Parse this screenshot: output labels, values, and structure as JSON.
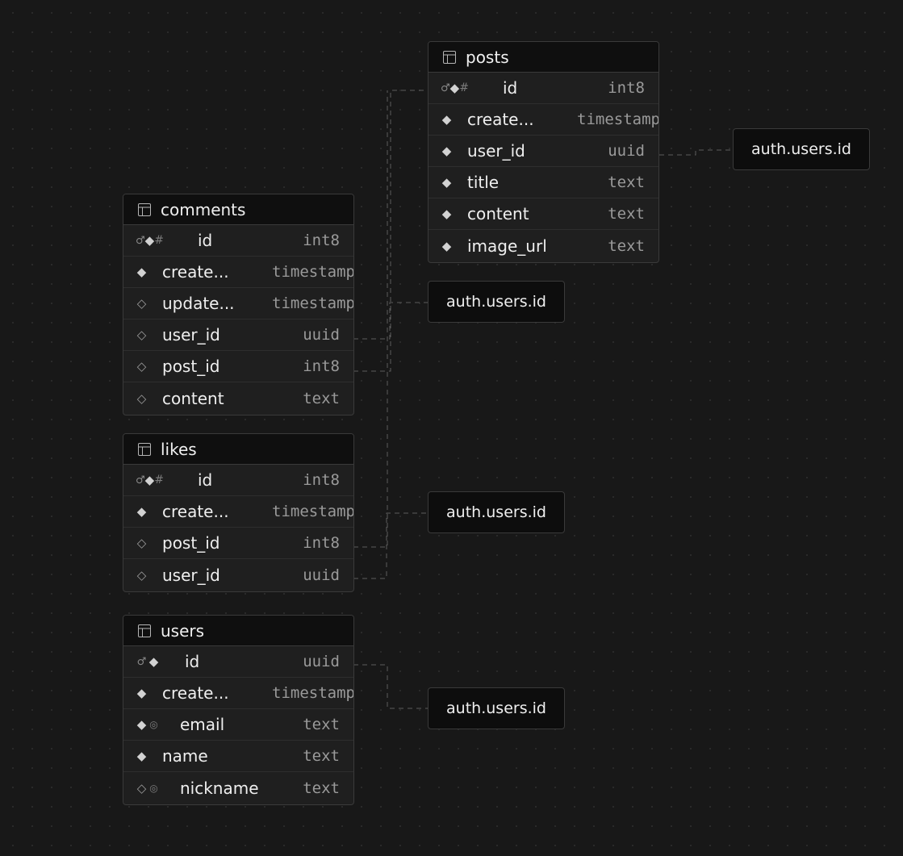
{
  "tables": [
    {
      "name": "posts",
      "columns": [
        {
          "name": "id",
          "type": "int8",
          "icons": [
            "key",
            "diamond",
            "hash"
          ]
        },
        {
          "name": "create...",
          "type": "timestamp",
          "icons": [
            "diamond"
          ]
        },
        {
          "name": "user_id",
          "type": "uuid",
          "icons": [
            "diamond"
          ]
        },
        {
          "name": "title",
          "type": "text",
          "icons": [
            "diamond"
          ]
        },
        {
          "name": "content",
          "type": "text",
          "icons": [
            "diamond"
          ]
        },
        {
          "name": "image_url",
          "type": "text",
          "icons": [
            "diamond"
          ]
        }
      ]
    },
    {
      "name": "comments",
      "columns": [
        {
          "name": "id",
          "type": "int8",
          "icons": [
            "key",
            "diamond",
            "hash"
          ]
        },
        {
          "name": "create...",
          "type": "timestamp",
          "icons": [
            "diamond"
          ]
        },
        {
          "name": "update...",
          "type": "timestamp",
          "icons": [
            "odiamond"
          ]
        },
        {
          "name": "user_id",
          "type": "uuid",
          "icons": [
            "odiamond"
          ]
        },
        {
          "name": "post_id",
          "type": "int8",
          "icons": [
            "odiamond"
          ]
        },
        {
          "name": "content",
          "type": "text",
          "icons": [
            "odiamond"
          ]
        }
      ]
    },
    {
      "name": "likes",
      "columns": [
        {
          "name": "id",
          "type": "int8",
          "icons": [
            "key",
            "diamond",
            "hash"
          ]
        },
        {
          "name": "create...",
          "type": "timestamp",
          "icons": [
            "diamond"
          ]
        },
        {
          "name": "post_id",
          "type": "int8",
          "icons": [
            "odiamond"
          ]
        },
        {
          "name": "user_id",
          "type": "uuid",
          "icons": [
            "odiamond"
          ]
        }
      ]
    },
    {
      "name": "users",
      "columns": [
        {
          "name": "id",
          "type": "uuid",
          "icons": [
            "key",
            "diamond"
          ]
        },
        {
          "name": "create...",
          "type": "timestamp",
          "icons": [
            "diamond"
          ]
        },
        {
          "name": "email",
          "type": "text",
          "icons": [
            "diamond",
            "fingerprint"
          ]
        },
        {
          "name": "name",
          "type": "text",
          "icons": [
            "diamond"
          ]
        },
        {
          "name": "nickname",
          "type": "text",
          "icons": [
            "odiamond",
            "fingerprint"
          ]
        }
      ]
    }
  ],
  "refs": [
    "auth.users.id",
    "auth.users.id",
    "auth.users.id",
    "auth.users.id"
  ],
  "colors": {
    "background": "#181818",
    "node_header": "#0f0f0f",
    "node_body": "#1f1f1f",
    "border": "#3a3a3a",
    "edge": "#5a5a5a"
  }
}
